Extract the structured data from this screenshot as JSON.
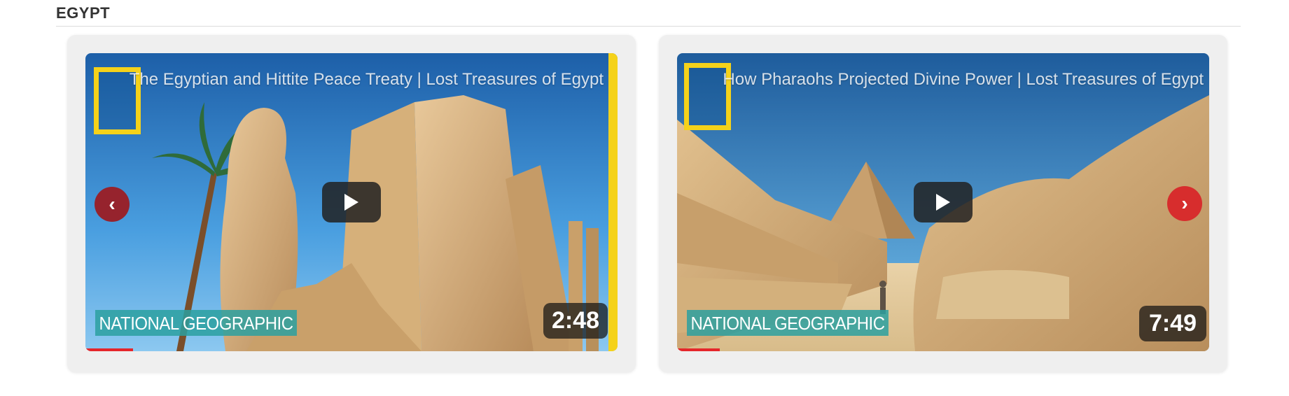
{
  "section": {
    "title": "EGYPT"
  },
  "carousel": {
    "prev_label": "‹",
    "next_label": "›",
    "prev_color": "#96232d",
    "next_color": "#d72d2d"
  },
  "videos": [
    {
      "title": "The Egyptian and Hittite Peace Treaty | Lost Treasures of Egypt",
      "brand": "NATIONAL GEOGRAPHIC",
      "duration": "2:48",
      "progress_fraction": 0.09
    },
    {
      "title": "How Pharaohs Projected Divine Power | Lost Treasures of Egypt",
      "brand": "NATIONAL GEOGRAPHIC",
      "duration": "7:49",
      "progress_fraction": 0.08
    }
  ],
  "icons": {
    "play": "play-icon",
    "logo": "national-geographic-frame-icon"
  },
  "colors": {
    "ng_yellow": "#f5d21a",
    "badge_teal": "#2ba0a0",
    "progress_red": "#e5262b"
  }
}
